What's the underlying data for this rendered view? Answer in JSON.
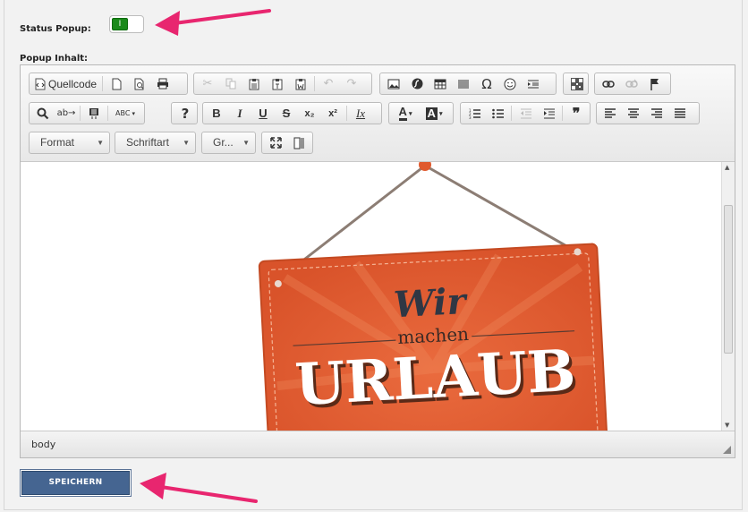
{
  "form": {
    "status_label": "Status Popup:",
    "toggle_text": "I",
    "content_label": "Popup Inhalt:"
  },
  "toolbar": {
    "row1": {
      "source_label": "Quellcode",
      "buttons": [
        "new-page",
        "preview",
        "print",
        "cut",
        "copy",
        "paste",
        "paste-text",
        "paste-word",
        "undo",
        "redo",
        "image",
        "flash",
        "table",
        "horizontal-line",
        "special-char",
        "smiley",
        "iframe",
        "qr-code",
        "link",
        "unlink",
        "anchor"
      ]
    },
    "row2": {
      "find_icon": "🔍",
      "replace_icon": "ab→",
      "select_all_icon": "▤",
      "spellcheck_icon": "ABC",
      "help_icon": "?",
      "bold": "B",
      "italic": "I",
      "underline": "U",
      "strike": "S",
      "subscript": "x₂",
      "superscript": "x²",
      "remove_format": "Ix",
      "text_color": "A",
      "bg_color": "A",
      "blockquote": "❞"
    },
    "row3": {
      "format_label": "Format",
      "font_label": "Schriftart",
      "size_label": "Gr..."
    }
  },
  "content": {
    "sign_line1": "Wir",
    "sign_line2": "machen",
    "sign_line3": "URLAUB"
  },
  "statusbar": {
    "path": "body"
  },
  "actions": {
    "save_label": "SPEICHERN"
  },
  "colors": {
    "toggle_on": "#1a8a1a",
    "sign_orange": "#e05a2e",
    "arrow_pink": "#e8266f",
    "save_button": "#456591"
  }
}
